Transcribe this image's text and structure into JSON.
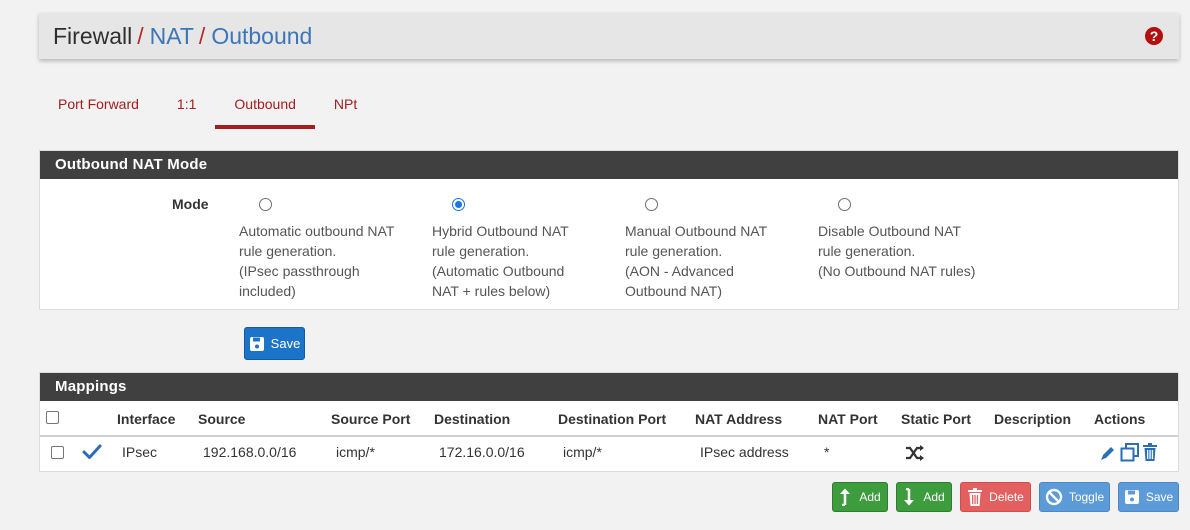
{
  "breadcrumb": {
    "root": "Firewall",
    "separator": "/",
    "items": [
      "NAT",
      "Outbound"
    ]
  },
  "help_icon": "question-circle-icon",
  "tabs": [
    {
      "label": "Port Forward",
      "active": false
    },
    {
      "label": "1:1",
      "active": false
    },
    {
      "label": "Outbound",
      "active": true
    },
    {
      "label": "NPt",
      "active": false
    }
  ],
  "mode_panel": {
    "title": "Outbound NAT Mode",
    "mode_label": "Mode",
    "options": [
      {
        "lines": [
          "Automatic outbound NAT",
          "rule generation.",
          "(IPsec passthrough",
          "included)"
        ],
        "checked": false
      },
      {
        "lines": [
          "Hybrid Outbound NAT",
          "rule generation.",
          "(Automatic Outbound",
          "NAT + rules below)"
        ],
        "checked": true
      },
      {
        "lines": [
          "Manual Outbound NAT",
          "rule generation.",
          "(AON - Advanced",
          "Outbound NAT)"
        ],
        "checked": false
      },
      {
        "lines": [
          "Disable Outbound NAT",
          "rule generation.",
          "(No Outbound NAT rules)"
        ],
        "checked": false
      }
    ],
    "save_label": "Save"
  },
  "mappings": {
    "title": "Mappings",
    "columns": [
      "Interface",
      "Source",
      "Source Port",
      "Destination",
      "Destination Port",
      "NAT Address",
      "NAT Port",
      "Static Port",
      "Description",
      "Actions"
    ],
    "rows": [
      {
        "enabled": true,
        "interface": "IPsec",
        "source": "192.168.0.0/16",
        "source_port": "icmp/*",
        "destination": "172.16.0.0/16",
        "destination_port": "icmp/*",
        "nat_address": "IPsec address",
        "nat_port": "*",
        "static_port_icon": "shuffle-icon",
        "description": ""
      }
    ]
  },
  "bottom_buttons": {
    "add_top": "Add",
    "add_bottom": "Add",
    "delete": "Delete",
    "toggle": "Toggle",
    "save": "Save"
  },
  "colors": {
    "accent_red": "#a31e1e",
    "link_blue": "#3a76b8",
    "panel_header": "#404040",
    "btn_blue": "#1c74c9",
    "btn_green": "#3d9c3e",
    "btn_red": "#e36060",
    "btn_light_blue": "#5d9ad8"
  }
}
